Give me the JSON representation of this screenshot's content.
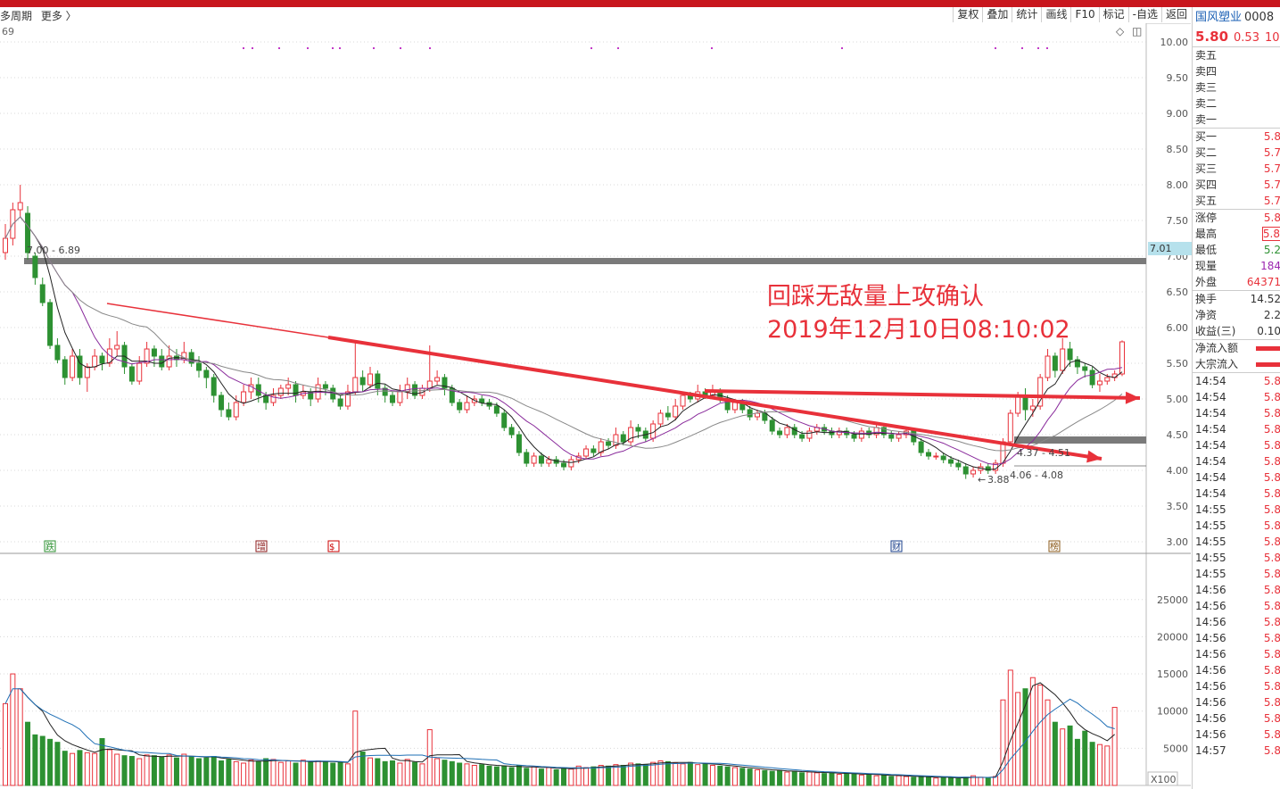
{
  "toolbar": {
    "left": [
      "多周期",
      "更多 〉"
    ],
    "buttons": [
      "复权",
      "叠加",
      "统计",
      "画线",
      "F10",
      "标记",
      "-自选",
      "返回"
    ]
  },
  "chart": {
    "indicator_value": "69",
    "price_axis": [
      "10.00",
      "9.50",
      "9.00",
      "8.50",
      "8.00",
      "7.50",
      "7.00",
      "6.50",
      "6.00",
      "5.50",
      "5.00",
      "4.50",
      "4.00",
      "3.50",
      "3.00"
    ],
    "volume_axis": [
      "25000",
      "20000",
      "15000",
      "10000",
      "5000"
    ],
    "volume_unit": "X100",
    "current_price_marker": "7.01",
    "annotations": {
      "line1": "回踩无敌量上攻确认",
      "line2": "2019年12月10日08:10:02"
    },
    "labels": {
      "resistance": "7.00 - 6.89",
      "low": "3.88",
      "support1": "4.06 - 4.08",
      "support2": "4.37 - 4.51"
    },
    "event_markers": [
      "跌",
      "增",
      "$",
      "财",
      "榜"
    ],
    "colors": {
      "up": "#e8313a",
      "down": "#2d9132",
      "ma5": "#222222",
      "ma10": "#8a2c9c",
      "ma20": "#888888",
      "band": "#7a7a7a",
      "arrow": "#e8313a"
    }
  },
  "chart_data": {
    "type": "candlestick",
    "y_range": [
      2.9,
      10.2
    ],
    "volume_range": [
      0,
      27000
    ],
    "candles": [
      [
        7.05,
        7.25,
        7.45,
        6.95
      ],
      [
        7.25,
        7.65,
        7.75,
        7.15
      ],
      [
        7.65,
        7.75,
        8.0,
        7.55
      ],
      [
        7.6,
        7.05,
        7.7,
        6.95
      ],
      [
        7.0,
        6.7,
        7.05,
        6.6
      ],
      [
        6.6,
        6.35,
        6.7,
        6.3
      ],
      [
        6.35,
        5.75,
        6.4,
        5.7
      ],
      [
        5.75,
        5.55,
        5.85,
        5.5
      ],
      [
        5.55,
        5.3,
        5.6,
        5.2
      ],
      [
        5.3,
        5.6,
        5.7,
        5.25
      ],
      [
        5.6,
        5.3,
        5.7,
        5.2
      ],
      [
        5.3,
        5.45,
        5.5,
        5.1
      ],
      [
        5.45,
        5.6,
        5.7,
        5.4
      ],
      [
        5.6,
        5.5,
        5.65,
        5.4
      ],
      [
        5.5,
        5.7,
        5.85,
        5.45
      ],
      [
        5.7,
        5.75,
        5.95,
        5.6
      ],
      [
        5.75,
        5.45,
        5.8,
        5.35
      ],
      [
        5.45,
        5.25,
        5.5,
        5.2
      ],
      [
        5.25,
        5.5,
        5.6,
        5.2
      ],
      [
        5.5,
        5.7,
        5.8,
        5.45
      ],
      [
        5.7,
        5.6,
        5.75,
        5.45
      ],
      [
        5.6,
        5.45,
        5.7,
        5.4
      ],
      [
        5.45,
        5.6,
        5.75,
        5.4
      ],
      [
        5.6,
        5.55,
        5.7,
        5.45
      ],
      [
        5.55,
        5.65,
        5.8,
        5.5
      ],
      [
        5.65,
        5.5,
        5.7,
        5.45
      ],
      [
        5.5,
        5.4,
        5.6,
        5.3
      ],
      [
        5.4,
        5.3,
        5.45,
        5.15
      ],
      [
        5.3,
        5.05,
        5.35,
        4.95
      ],
      [
        5.05,
        4.85,
        5.1,
        4.75
      ],
      [
        4.85,
        4.75,
        4.95,
        4.7
      ],
      [
        4.75,
        4.95,
        5.05,
        4.7
      ],
      [
        4.95,
        5.1,
        5.2,
        4.9
      ],
      [
        5.1,
        5.2,
        5.3,
        5.0
      ],
      [
        5.2,
        5.05,
        5.3,
        4.95
      ],
      [
        5.05,
        4.95,
        5.1,
        4.85
      ],
      [
        4.95,
        5.05,
        5.15,
        4.9
      ],
      [
        5.05,
        5.15,
        5.2,
        5.0
      ],
      [
        5.15,
        5.2,
        5.3,
        5.05
      ],
      [
        5.2,
        5.05,
        5.25,
        4.95
      ],
      [
        5.05,
        5.1,
        5.2,
        5.0
      ],
      [
        5.1,
        5.0,
        5.15,
        4.9
      ],
      [
        5.0,
        5.2,
        5.3,
        4.95
      ],
      [
        5.2,
        5.15,
        5.25,
        5.05
      ],
      [
        5.15,
        5.0,
        5.2,
        4.95
      ],
      [
        5.0,
        4.9,
        5.05,
        4.85
      ],
      [
        4.9,
        5.1,
        5.2,
        4.85
      ],
      [
        5.1,
        5.3,
        5.8,
        5.05
      ],
      [
        5.3,
        5.2,
        5.4,
        5.1
      ],
      [
        5.2,
        5.35,
        5.45,
        5.15
      ],
      [
        5.35,
        5.15,
        5.4,
        5.05
      ],
      [
        5.15,
        5.05,
        5.2,
        4.95
      ],
      [
        5.05,
        4.95,
        5.1,
        4.9
      ],
      [
        4.95,
        5.1,
        5.2,
        4.9
      ],
      [
        5.1,
        5.2,
        5.3,
        5.0
      ],
      [
        5.2,
        5.05,
        5.25,
        5.0
      ],
      [
        5.05,
        5.15,
        5.2,
        5.0
      ],
      [
        5.15,
        5.25,
        5.75,
        5.1
      ],
      [
        5.25,
        5.3,
        5.4,
        5.2
      ],
      [
        5.3,
        5.15,
        5.35,
        5.05
      ],
      [
        5.15,
        4.95,
        5.2,
        4.9
      ],
      [
        4.95,
        4.85,
        5.0,
        4.8
      ],
      [
        4.85,
        4.95,
        5.05,
        4.8
      ],
      [
        4.95,
        5.0,
        5.05,
        4.9
      ],
      [
        5.0,
        4.95,
        5.05,
        4.9
      ],
      [
        4.95,
        4.9,
        5.0,
        4.85
      ],
      [
        4.9,
        4.8,
        4.95,
        4.75
      ],
      [
        4.8,
        4.6,
        4.85,
        4.55
      ],
      [
        4.6,
        4.5,
        4.65,
        4.45
      ],
      [
        4.5,
        4.25,
        4.55,
        4.2
      ],
      [
        4.25,
        4.1,
        4.3,
        4.05
      ],
      [
        4.1,
        4.2,
        4.25,
        4.05
      ],
      [
        4.2,
        4.1,
        4.25,
        4.05
      ],
      [
        4.1,
        4.15,
        4.2,
        4.05
      ],
      [
        4.15,
        4.1,
        4.2,
        4.05
      ],
      [
        4.1,
        4.05,
        4.15,
        4.0
      ],
      [
        4.05,
        4.15,
        4.2,
        4.0
      ],
      [
        4.15,
        4.2,
        4.25,
        4.1
      ],
      [
        4.2,
        4.3,
        4.35,
        4.15
      ],
      [
        4.3,
        4.25,
        4.35,
        4.2
      ],
      [
        4.25,
        4.4,
        4.45,
        4.2
      ],
      [
        4.4,
        4.35,
        4.45,
        4.3
      ],
      [
        4.35,
        4.5,
        4.6,
        4.3
      ],
      [
        4.5,
        4.4,
        4.55,
        4.35
      ],
      [
        4.4,
        4.6,
        4.7,
        4.35
      ],
      [
        4.6,
        4.55,
        4.65,
        4.45
      ],
      [
        4.55,
        4.45,
        4.6,
        4.4
      ],
      [
        4.45,
        4.65,
        4.7,
        4.4
      ],
      [
        4.65,
        4.8,
        4.85,
        4.6
      ],
      [
        4.8,
        4.75,
        4.9,
        4.7
      ],
      [
        4.75,
        4.9,
        5.0,
        4.7
      ],
      [
        4.9,
        5.05,
        5.1,
        4.85
      ],
      [
        5.05,
        5.0,
        5.1,
        4.95
      ],
      [
        5.0,
        5.1,
        5.2,
        4.95
      ],
      [
        5.1,
        5.05,
        5.15,
        5.0
      ],
      [
        5.05,
        5.1,
        5.2,
        5.0
      ],
      [
        5.1,
        5.0,
        5.15,
        4.95
      ],
      [
        5.0,
        4.85,
        5.05,
        4.8
      ],
      [
        4.85,
        4.95,
        5.0,
        4.8
      ],
      [
        4.95,
        4.85,
        5.0,
        4.8
      ],
      [
        4.85,
        4.75,
        4.9,
        4.7
      ],
      [
        4.75,
        4.8,
        4.85,
        4.7
      ],
      [
        4.8,
        4.7,
        4.85,
        4.65
      ],
      [
        4.7,
        4.55,
        4.75,
        4.5
      ],
      [
        4.55,
        4.5,
        4.6,
        4.45
      ],
      [
        4.5,
        4.6,
        4.65,
        4.45
      ],
      [
        4.6,
        4.5,
        4.65,
        4.45
      ],
      [
        4.5,
        4.45,
        4.55,
        4.4
      ],
      [
        4.45,
        4.55,
        4.6,
        4.4
      ],
      [
        4.55,
        4.6,
        4.65,
        4.5
      ],
      [
        4.6,
        4.55,
        4.65,
        4.5
      ],
      [
        4.55,
        4.5,
        4.6,
        4.45
      ],
      [
        4.5,
        4.55,
        4.6,
        4.45
      ],
      [
        4.55,
        4.5,
        4.6,
        4.45
      ],
      [
        4.5,
        4.45,
        4.55,
        4.4
      ],
      [
        4.45,
        4.55,
        4.6,
        4.4
      ],
      [
        4.55,
        4.5,
        4.6,
        4.45
      ],
      [
        4.5,
        4.6,
        4.65,
        4.45
      ],
      [
        4.6,
        4.5,
        4.65,
        4.45
      ],
      [
        4.5,
        4.45,
        4.55,
        4.4
      ],
      [
        4.45,
        4.5,
        4.55,
        4.4
      ],
      [
        4.5,
        4.55,
        4.6,
        4.45
      ],
      [
        4.55,
        4.4,
        4.6,
        4.35
      ],
      [
        4.4,
        4.25,
        4.45,
        4.2
      ],
      [
        4.25,
        4.2,
        4.3,
        4.15
      ],
      [
        4.2,
        4.2,
        4.25,
        4.15
      ],
      [
        4.2,
        4.15,
        4.25,
        4.1
      ],
      [
        4.15,
        4.1,
        4.2,
        4.05
      ],
      [
        4.1,
        4.05,
        4.15,
        4.0
      ],
      [
        4.05,
        3.95,
        4.1,
        3.88
      ],
      [
        3.95,
        4.0,
        4.05,
        3.9
      ],
      [
        4.0,
        4.05,
        4.1,
        3.95
      ],
      [
        4.05,
        4.0,
        4.1,
        3.95
      ],
      [
        4.0,
        4.1,
        4.15,
        3.95
      ],
      [
        4.1,
        4.4,
        4.45,
        4.05
      ],
      [
        4.4,
        4.8,
        4.85,
        4.35
      ],
      [
        4.8,
        5.05,
        5.1,
        4.75
      ],
      [
        5.05,
        4.85,
        5.15,
        4.7
      ],
      [
        4.85,
        4.9,
        5.0,
        4.75
      ],
      [
        4.9,
        5.3,
        5.35,
        4.85
      ],
      [
        5.3,
        5.6,
        5.7,
        5.25
      ],
      [
        5.6,
        5.4,
        5.65,
        5.3
      ],
      [
        5.4,
        5.7,
        5.85,
        5.35
      ],
      [
        5.7,
        5.55,
        5.8,
        5.45
      ],
      [
        5.55,
        5.45,
        5.6,
        5.35
      ],
      [
        5.45,
        5.4,
        5.5,
        5.3
      ],
      [
        5.4,
        5.2,
        5.45,
        5.15
      ],
      [
        5.2,
        5.25,
        5.35,
        5.1
      ],
      [
        5.25,
        5.3,
        5.35,
        5.2
      ],
      [
        5.3,
        5.35,
        5.4,
        5.25
      ],
      [
        5.35,
        5.8,
        5.82,
        5.32
      ]
    ],
    "volume": [
      11000,
      15000,
      13000,
      8500,
      6800,
      6600,
      6200,
      5800,
      4600,
      4300,
      4700,
      4400,
      4300,
      6300,
      4800,
      4200,
      4000,
      3900,
      3600,
      4100,
      4000,
      3800,
      4100,
      3700,
      4200,
      3900,
      3600,
      3700,
      3900,
      3300,
      3500,
      3200,
      3000,
      3400,
      3200,
      3600,
      3500,
      3100,
      3300,
      3000,
      3400,
      3100,
      3300,
      3200,
      3000,
      3100,
      2900,
      10000,
      4500,
      3700,
      3600,
      3200,
      3300,
      3000,
      3500,
      3100,
      2900,
      7500,
      3600,
      3400,
      3200,
      3000,
      2900,
      2700,
      2800,
      2600,
      2500,
      2600,
      2400,
      2700,
      2300,
      2500,
      2200,
      2400,
      2100,
      2300,
      2200,
      2600,
      2400,
      2500,
      2700,
      2600,
      2800,
      2700,
      3000,
      2900,
      2800,
      3100,
      3300,
      3200,
      3000,
      2900,
      3100,
      2800,
      2900,
      2700,
      2600,
      2500,
      2400,
      2300,
      2200,
      2100,
      2000,
      1900,
      2000,
      1800,
      1900,
      1700,
      1800,
      1700,
      1600,
      1700,
      1500,
      1600,
      1500,
      1400,
      1500,
      1300,
      1400,
      1200,
      1300,
      1200,
      1100,
      1200,
      1100,
      1000,
      1100,
      1000,
      900,
      1100,
      1300,
      1100,
      1000,
      1200,
      11500,
      15500,
      12500,
      13000,
      14500,
      13500,
      11500,
      8500,
      7600,
      8000,
      6200,
      7300,
      5800,
      5500,
      5300,
      10500
    ]
  },
  "quote": {
    "name": "国风塑业",
    "code": "0008",
    "price": "5.80",
    "change": "0.53",
    "pct": "10.",
    "asks": [
      {
        "label": "卖五"
      },
      {
        "label": "卖四"
      },
      {
        "label": "卖三"
      },
      {
        "label": "卖二"
      },
      {
        "label": "卖一"
      }
    ],
    "bids": [
      {
        "label": "买一",
        "value": "5.8"
      },
      {
        "label": "买二",
        "value": "5.7"
      },
      {
        "label": "买三",
        "value": "5.7"
      },
      {
        "label": "买四",
        "value": "5.7"
      },
      {
        "label": "买五",
        "value": "5.7"
      }
    ],
    "stats": [
      {
        "label": "涨停",
        "value": "5.8",
        "color": "#e8313a"
      },
      {
        "label": "最高",
        "value": "5.8",
        "color": "#e8313a"
      },
      {
        "label": "最低",
        "value": "5.2",
        "color": "#2d9132"
      },
      {
        "label": "现量",
        "value": "184",
        "color": "#9c27b0"
      },
      {
        "label": "外盘",
        "value": "64371",
        "color": "#e8313a"
      }
    ],
    "stats2": [
      {
        "label": "换手",
        "value": "14.52",
        "color": "#333333"
      },
      {
        "label": "净资",
        "value": "2.2",
        "color": "#333333"
      },
      {
        "label": "收益(三)",
        "value": "0.10",
        "color": "#333333"
      }
    ],
    "flows": [
      {
        "label": "净流入额"
      },
      {
        "label": "大宗流入"
      }
    ],
    "ticks": [
      {
        "t": "14:54",
        "v": "5.8"
      },
      {
        "t": "14:54",
        "v": "5.8"
      },
      {
        "t": "14:54",
        "v": "5.8"
      },
      {
        "t": "14:54",
        "v": "5.8"
      },
      {
        "t": "14:54",
        "v": "5.8"
      },
      {
        "t": "14:54",
        "v": "5.8"
      },
      {
        "t": "14:54",
        "v": "5.8"
      },
      {
        "t": "14:54",
        "v": "5.8"
      },
      {
        "t": "14:55",
        "v": "5.8"
      },
      {
        "t": "14:55",
        "v": "5.8"
      },
      {
        "t": "14:55",
        "v": "5.8"
      },
      {
        "t": "14:55",
        "v": "5.8"
      },
      {
        "t": "14:55",
        "v": "5.8"
      },
      {
        "t": "14:56",
        "v": "5.8"
      },
      {
        "t": "14:56",
        "v": "5.8"
      },
      {
        "t": "14:56",
        "v": "5.8"
      },
      {
        "t": "14:56",
        "v": "5.8"
      },
      {
        "t": "14:56",
        "v": "5.8"
      },
      {
        "t": "14:56",
        "v": "5.8"
      },
      {
        "t": "14:56",
        "v": "5.8"
      },
      {
        "t": "14:56",
        "v": "5.8"
      },
      {
        "t": "14:56",
        "v": "5.8"
      },
      {
        "t": "14:56",
        "v": "5.8"
      },
      {
        "t": "14:57",
        "v": "5.8"
      }
    ]
  }
}
